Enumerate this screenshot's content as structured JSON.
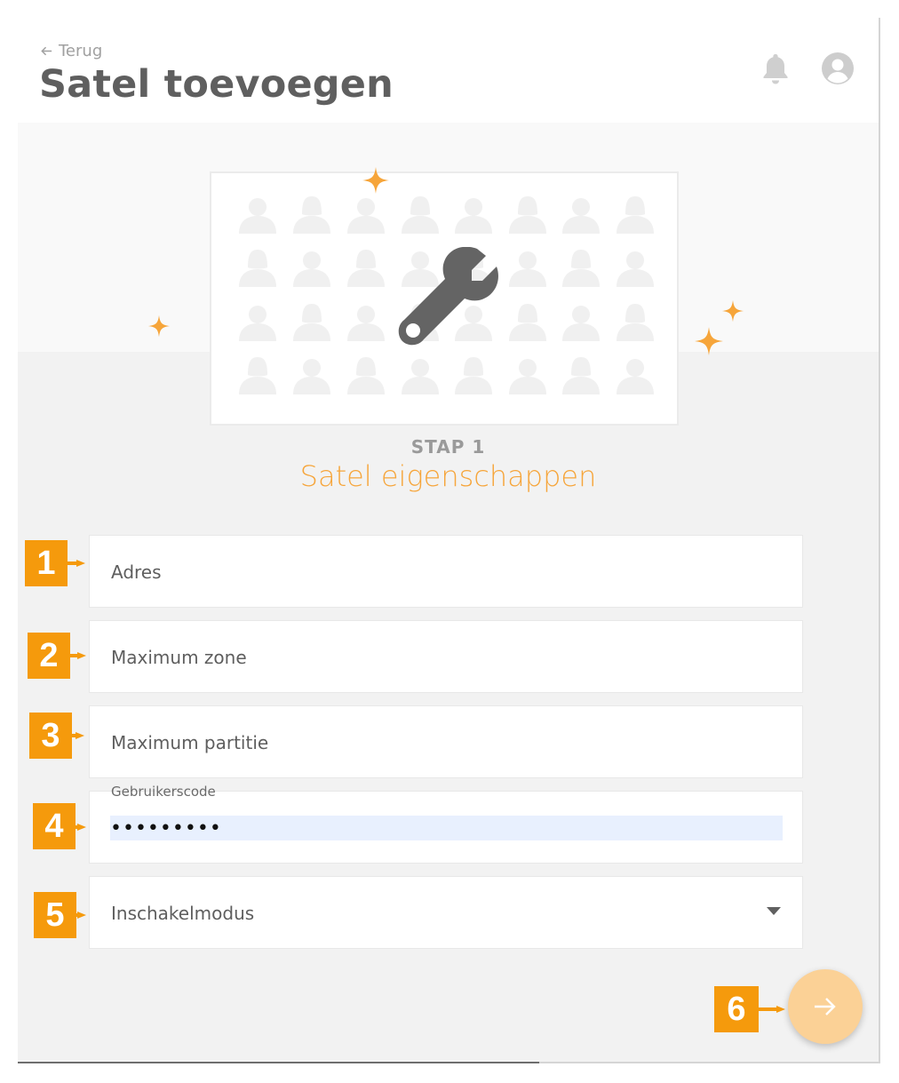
{
  "header": {
    "back_label": "Terug",
    "title": "Satel toevoegen",
    "icons": {
      "notifications": "bell-icon",
      "account": "user-avatar-icon"
    }
  },
  "illustration": {
    "main_icon": "wrench-icon",
    "background": "people-grid",
    "decorations": "sparkle-icon"
  },
  "step": {
    "label": "STAP 1",
    "title": "Satel eigenschappen"
  },
  "form": {
    "address": {
      "placeholder": "Adres",
      "value": ""
    },
    "max_zone": {
      "placeholder": "Maximum zone",
      "value": ""
    },
    "max_partition": {
      "placeholder": "Maximum partitie",
      "value": ""
    },
    "user_code": {
      "label": "Gebruikerscode",
      "value": "•••••••••"
    },
    "arm_mode": {
      "placeholder": "Inschakelmodus",
      "selected": ""
    }
  },
  "annotations": [
    "1",
    "2",
    "3",
    "4",
    "5",
    "6"
  ],
  "actions": {
    "next_icon": "arrow-right-icon"
  },
  "colors": {
    "accent": "#f6a53a",
    "badge": "#f59a0c",
    "next_button": "#fbd196",
    "autofill": "#e8f0fe"
  }
}
